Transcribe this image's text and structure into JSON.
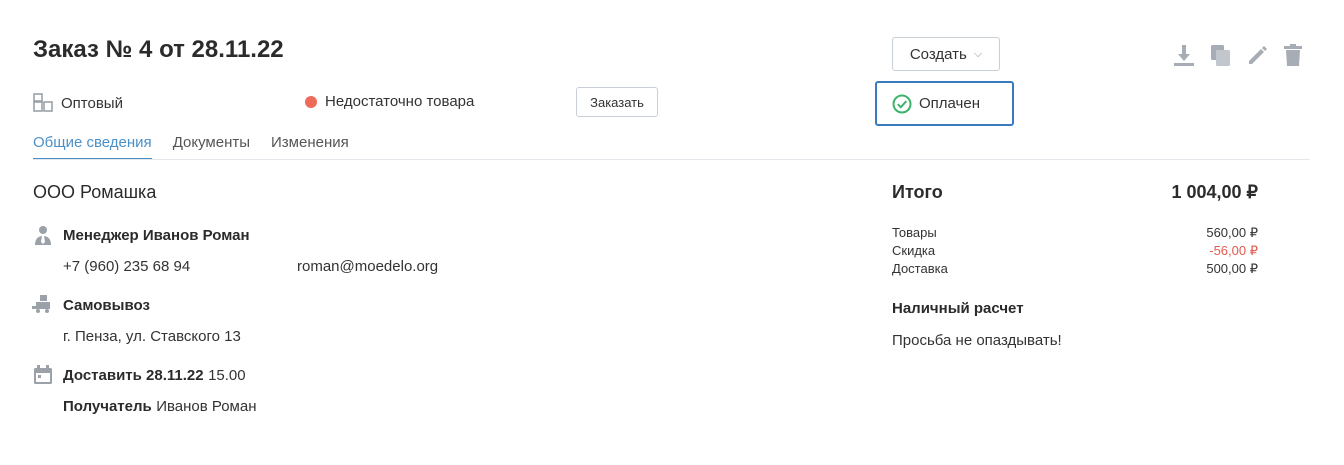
{
  "header": {
    "title": "Заказ № 4 от 28.11.22",
    "create_label": "Создать",
    "toolbar_icons": [
      "download-icon",
      "copy-icon",
      "edit-icon",
      "trash-icon"
    ]
  },
  "status_row": {
    "client_type": "Оптовый",
    "stock_status": "Недостаточно товара",
    "stock_status_color": "#ee6b5b",
    "order_button": "Заказать",
    "payment_status": "Оплачен",
    "payment_status_color": "#3db36b"
  },
  "tabs": [
    {
      "label": "Общие сведения",
      "active": true
    },
    {
      "label": "Документы",
      "active": false
    },
    {
      "label": "Изменения",
      "active": false
    }
  ],
  "details": {
    "company": "ООО Ромашка",
    "manager_label": "Менеджер Иванов Роман",
    "phone": "+7 (960) 235 68 94",
    "email": "roman@moedelo.org",
    "delivery_method": "Самовывоз",
    "address": "г. Пенза, ул. Ставского 13",
    "deliver_label": "Доставить 28.11.22",
    "deliver_time": "15.00",
    "recipient_label": "Получатель",
    "recipient_name": "Иванов Роман"
  },
  "summary": {
    "total_label": "Итого",
    "total_value": "1 004,00 ₽",
    "rows": [
      {
        "label": "Товары",
        "value": "560,00 ₽"
      },
      {
        "label": "Скидка",
        "value": "-56,00 ₽"
      },
      {
        "label": "Доставка",
        "value": "500,00 ₽"
      }
    ],
    "payment_method": "Наличный расчет",
    "comment": "Просьба не опаздывать!"
  },
  "colors": {
    "accent": "#4a90c8",
    "focus_border": "#3a7abf",
    "negative": "#e05a4f"
  }
}
